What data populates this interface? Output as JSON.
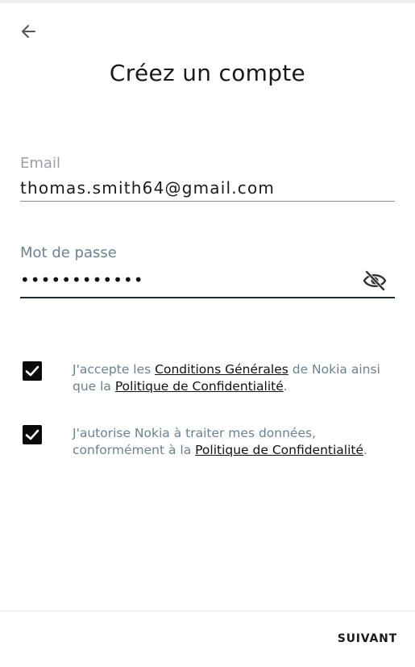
{
  "header": {
    "title": "Créez un compte",
    "back_icon": "arrow-left-icon"
  },
  "form": {
    "email": {
      "label": "Email",
      "value": "thomas.smith64@gmail.com"
    },
    "password": {
      "label": "Mot de passe",
      "masked_value": "••••••••••••",
      "toggle_icon": "eye-off-icon"
    }
  },
  "consents": [
    {
      "checked": true,
      "before": "J'accepte les ",
      "link1": "Conditions Générales",
      "middle": " de Nokia ainsi que la ",
      "link2": "Politique de Confidentialité",
      "after": "."
    },
    {
      "checked": true,
      "before": "J'autorise Nokia à traiter mes données, conformément à la ",
      "link1": "Politique de Confidentialité",
      "after": "."
    }
  ],
  "footer": {
    "next_label": "SUIVANT"
  },
  "colors": {
    "label_active": "#6b8291",
    "label_inactive": "#9aa0a6",
    "checkbox": "#0a0a0a",
    "underline_active": "#1b2a33"
  }
}
